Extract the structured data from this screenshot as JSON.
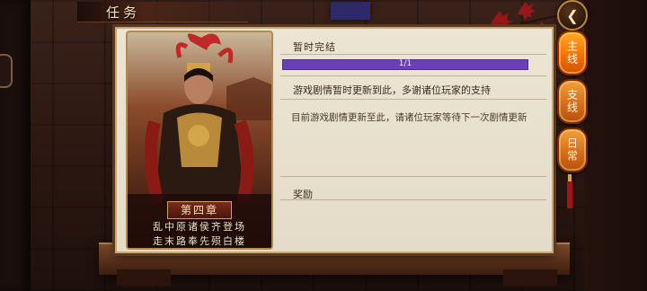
{
  "header": {
    "title": "任务"
  },
  "nav": {
    "back_icon": "back-arrow-icon",
    "back_glyph": "❮"
  },
  "tabs": [
    {
      "label": "主线",
      "active": true
    },
    {
      "label": "支线",
      "active": false
    },
    {
      "label": "日常",
      "active": false
    }
  ],
  "chapter_card": {
    "badge": "第四章",
    "line1": "乱中原诸侯齐登场",
    "line2": "走末路奉先殒白楼"
  },
  "quest": {
    "status": "暂时完结",
    "progress_text": "1/1",
    "progress_fraction": 1.0,
    "message": "游戏剧情暂时更新到此，多谢诸位玩家的支持",
    "description": "目前游戏剧情更新至此，请诸位玩家等待下一次剧情更新",
    "reward_label": "奖励"
  },
  "colors": {
    "accent_purple": "#6a3fb8",
    "tab_orange": "#d46a18",
    "panel_bg": "#ece5d3"
  }
}
